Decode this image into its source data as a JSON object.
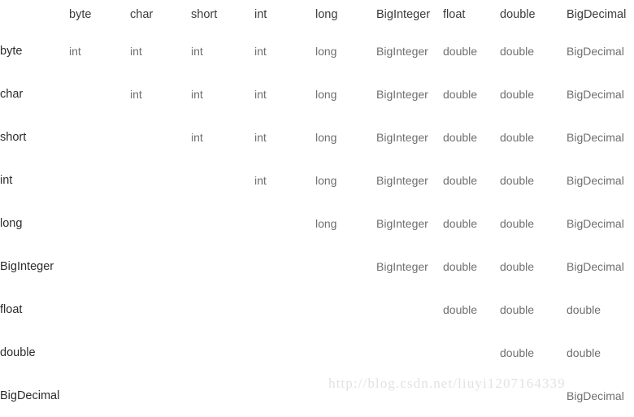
{
  "table": {
    "corner_label": "",
    "column_headers": [
      "byte",
      "char",
      "short",
      "int",
      "long",
      "BigInteger",
      "float",
      "double",
      "BigDecimal"
    ],
    "row_headers": [
      "byte",
      "char",
      "short",
      "int",
      "long",
      "BigInteger",
      "float",
      "double",
      "BigDecimal"
    ],
    "rows": [
      {
        "label": "byte",
        "cells": [
          "int",
          "int",
          "int",
          "int",
          "long",
          "BigInteger",
          "double",
          "double",
          "BigDecimal"
        ]
      },
      {
        "label": "char",
        "cells": [
          "",
          "int",
          "int",
          "int",
          "long",
          "BigInteger",
          "double",
          "double",
          "BigDecimal"
        ]
      },
      {
        "label": "short",
        "cells": [
          "",
          "",
          "int",
          "int",
          "long",
          "BigInteger",
          "double",
          "double",
          "BigDecimal"
        ]
      },
      {
        "label": "int",
        "cells": [
          "",
          "",
          "",
          "int",
          "long",
          "BigInteger",
          "double",
          "double",
          "BigDecimal"
        ]
      },
      {
        "label": "long",
        "cells": [
          "",
          "",
          "",
          "",
          "long",
          "BigInteger",
          "double",
          "double",
          "BigDecimal"
        ]
      },
      {
        "label": "BigInteger",
        "cells": [
          "",
          "",
          "",
          "",
          "",
          "BigInteger",
          "double",
          "double",
          "BigDecimal"
        ]
      },
      {
        "label": "float",
        "cells": [
          "",
          "",
          "",
          "",
          "",
          "",
          "double",
          "double",
          "double"
        ]
      },
      {
        "label": "double",
        "cells": [
          "",
          "",
          "",
          "",
          "",
          "",
          "",
          "double",
          "double"
        ]
      },
      {
        "label": "BigDecimal",
        "cells": [
          "",
          "",
          "",
          "",
          "",
          "",
          "",
          "",
          "BigDecimal"
        ]
      }
    ]
  },
  "watermark": {
    "text": "http://blog.csdn.net/liuyi1207164339"
  },
  "colors": {
    "background": "#ffffff",
    "header_text": "#3c3c3c",
    "row_label_text": "#2c2c2c",
    "cell_text": "#6f6f6f",
    "watermark_text": "#e2e2e2"
  }
}
